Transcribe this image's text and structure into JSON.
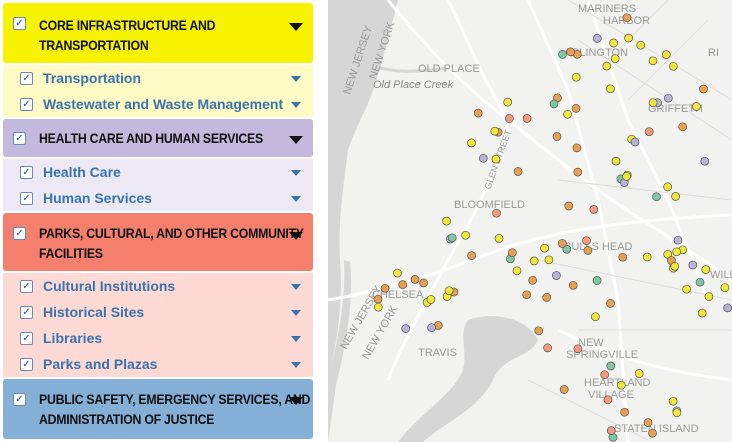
{
  "categories": [
    {
      "title": "CORE INFRASTRUCTURE AND TRANSPORTATION",
      "title_line1": "CORE INFRASTRUCTURE AND",
      "title_line2": "TRANSPORTATION",
      "color": "#f7f200",
      "checked": true,
      "subs": [
        {
          "label": "Transportation",
          "checked": true
        },
        {
          "label": "Wastewater and Waste Management",
          "checked": true
        }
      ],
      "sub_bg": "#fefcc4"
    },
    {
      "title": "HEALTH CARE AND HUMAN SERVICES",
      "color": "#c2b9dc",
      "checked": true,
      "subs": [
        {
          "label": "Health Care",
          "checked": true
        },
        {
          "label": "Human Services",
          "checked": true
        }
      ],
      "sub_bg": "#ece9f4"
    },
    {
      "title": "PARKS, CULTURAL, AND OTHER COMMUNITY FACILITIES",
      "title_line1": "PARKS, CULTURAL, AND OTHER COMMUNITY",
      "title_line2": "FACILITIES",
      "color": "#f47f6c",
      "checked": true,
      "subs": [
        {
          "label": "Cultural Institutions",
          "checked": true
        },
        {
          "label": "Historical Sites",
          "checked": true
        },
        {
          "label": "Libraries",
          "checked": true
        },
        {
          "label": "Parks and Plazas",
          "checked": true
        }
      ],
      "sub_bg": "#fcd9d2"
    },
    {
      "title": "PUBLIC SAFETY, EMERGENCY SERVICES, AND ADMINISTRATION OF JUSTICE",
      "title_line1": "PUBLIC SAFETY, EMERGENCY SERVICES, AND",
      "title_line2": "ADMINISTRATION OF JUSTICE",
      "color": "#84b0d8",
      "checked": true,
      "subs": []
    }
  ],
  "map": {
    "labels": {
      "mariners": "MARINERS",
      "harbor": "HARBOR",
      "arlington": "ARLINGTON",
      "old_place": "OLD PLACE",
      "old_place_creek": "Old Place Creek",
      "ri": "RI",
      "glen_street": "GLEN STREET",
      "griffeth": "GRIFFETH",
      "bloomfield": "BLOOMFIELD",
      "bulls_head": "BULLS HEAD",
      "will": "WILL",
      "chelsea": "CHELSEA",
      "travis": "TRAVIS",
      "new_springville_1": "NEW",
      "new_springville_2": "SPRINGVILLE",
      "heartland_1": "HEARTLAND",
      "heartland_2": "VILLAGE",
      "staten_island": "STATEN ISLAND",
      "new_jersey": "NEW JERSEY",
      "new_york": "NEW YORK"
    },
    "marker_colors": {
      "transportation": "#f0e838",
      "community": "#f49a7a",
      "health": "#b7b2d6",
      "parks": "#e8a050",
      "other": "#7fc6a4"
    }
  }
}
